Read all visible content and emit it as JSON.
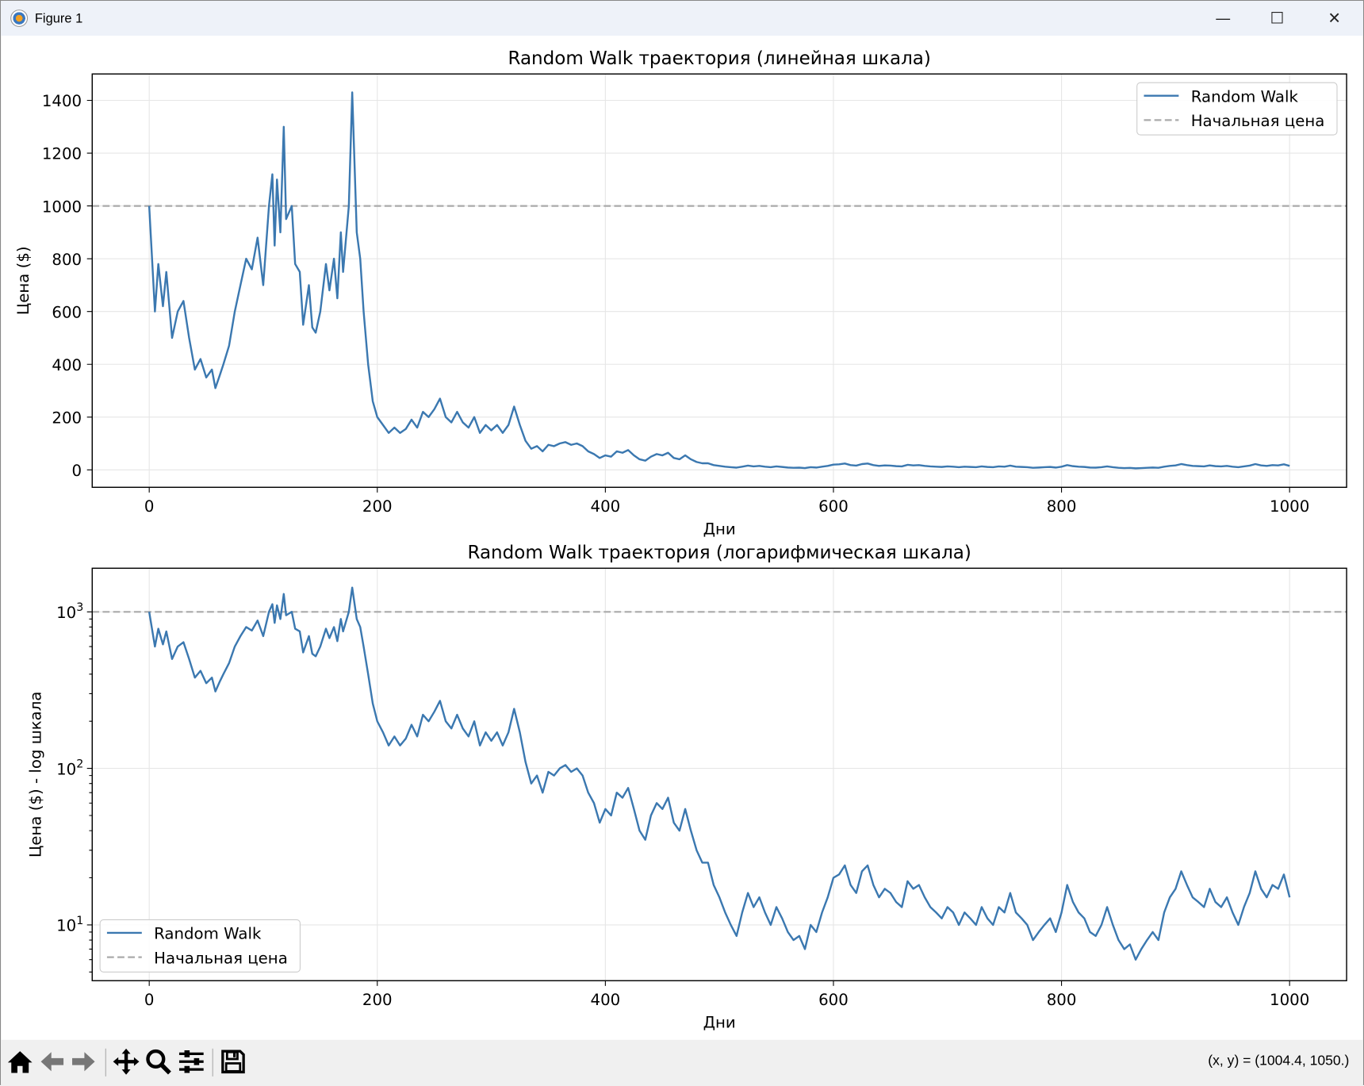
{
  "window": {
    "title": "Figure 1",
    "minimize": "—",
    "maximize": "☐",
    "close": "✕"
  },
  "toolbar": {
    "icons": [
      "home-icon",
      "back-icon",
      "forward-icon",
      "pan-icon",
      "zoom-icon",
      "configure-subplots-icon",
      "save-icon"
    ],
    "coords": "(x, y) = (1004.4, 1050.)"
  },
  "chart_data": [
    {
      "type": "line",
      "title": "Random Walk траектория (линейная шкала)",
      "xlabel": "Дни",
      "ylabel": "Цена ($)",
      "yscale": "linear",
      "xlim": [
        -50,
        1050
      ],
      "ylim": [
        -66,
        1500
      ],
      "xticks": [
        0,
        200,
        400,
        600,
        800,
        1000
      ],
      "xtick_labels": [
        "0",
        "200",
        "400",
        "600",
        "800",
        "1000"
      ],
      "yticks": [
        0,
        200,
        400,
        600,
        800,
        1000,
        1200,
        1400
      ],
      "ytick_labels": [
        "0",
        "200",
        "400",
        "600",
        "800",
        "1000",
        "1200",
        "1400"
      ],
      "grid": true,
      "legend": {
        "placement": "top-right",
        "entries": [
          "Random Walk",
          "Начальная цена"
        ]
      }
    },
    {
      "type": "line",
      "title": "Random Walk траектория (логарифмическая шкала)",
      "xlabel": "Дни",
      "ylabel": "Цена ($) - log шкала",
      "yscale": "log",
      "xlim": [
        -50,
        1050
      ],
      "ylim": [
        4.4,
        1900
      ],
      "xticks": [
        0,
        200,
        400,
        600,
        800,
        1000
      ],
      "xtick_labels": [
        "0",
        "200",
        "400",
        "600",
        "800",
        "1000"
      ],
      "yticks": [
        10,
        100,
        1000
      ],
      "ytick_labels": [
        [
          "10",
          "1"
        ],
        [
          "10",
          "2"
        ],
        [
          "10",
          "3"
        ]
      ],
      "grid": true,
      "legend": {
        "placement": "bottom-left",
        "entries": [
          "Random Walk",
          "Начальная цена"
        ]
      }
    }
  ],
  "series": {
    "random_walk": {
      "name": "Random Walk",
      "color": "#3b78b0",
      "x": [
        0,
        5,
        8,
        12,
        15,
        20,
        25,
        30,
        35,
        40,
        45,
        50,
        55,
        58,
        62,
        65,
        70,
        75,
        80,
        85,
        90,
        95,
        100,
        105,
        108,
        110,
        112,
        115,
        118,
        120,
        125,
        128,
        132,
        135,
        140,
        143,
        146,
        150,
        155,
        158,
        162,
        165,
        168,
        170,
        175,
        178,
        182,
        185,
        188,
        192,
        196,
        200,
        205,
        210,
        215,
        220,
        225,
        230,
        235,
        240,
        245,
        250,
        255,
        260,
        265,
        270,
        275,
        280,
        285,
        290,
        295,
        300,
        305,
        310,
        315,
        320,
        325,
        330,
        335,
        340,
        345,
        350,
        355,
        360,
        365,
        370,
        375,
        380,
        385,
        390,
        395,
        400,
        405,
        410,
        415,
        420,
        425,
        430,
        435,
        440,
        445,
        450,
        455,
        460,
        465,
        470,
        475,
        480,
        485,
        490,
        495,
        500,
        505,
        510,
        515,
        520,
        525,
        530,
        535,
        540,
        545,
        550,
        555,
        560,
        565,
        570,
        575,
        580,
        585,
        590,
        595,
        600,
        605,
        610,
        615,
        620,
        625,
        630,
        635,
        640,
        645,
        650,
        655,
        660,
        665,
        670,
        675,
        680,
        685,
        690,
        695,
        700,
        705,
        710,
        715,
        720,
        725,
        730,
        735,
        740,
        745,
        750,
        755,
        760,
        765,
        770,
        775,
        780,
        785,
        790,
        795,
        800,
        805,
        810,
        815,
        820,
        825,
        830,
        835,
        840,
        845,
        850,
        855,
        860,
        865,
        870,
        875,
        880,
        885,
        890,
        895,
        900,
        905,
        910,
        915,
        920,
        925,
        930,
        935,
        940,
        945,
        950,
        955,
        960,
        965,
        970,
        975,
        980,
        985,
        990,
        995,
        1000
      ],
      "y": [
        1000,
        600,
        780,
        620,
        750,
        500,
        600,
        640,
        500,
        380,
        420,
        350,
        380,
        310,
        360,
        400,
        470,
        600,
        700,
        800,
        760,
        880,
        700,
        1000,
        1120,
        850,
        1100,
        900,
        1300,
        950,
        1000,
        780,
        750,
        550,
        700,
        540,
        520,
        600,
        780,
        680,
        800,
        650,
        900,
        750,
        1000,
        1430,
        900,
        800,
        600,
        400,
        260,
        200,
        170,
        140,
        160,
        140,
        155,
        190,
        160,
        220,
        200,
        230,
        270,
        200,
        180,
        220,
        180,
        160,
        200,
        140,
        170,
        150,
        170,
        140,
        170,
        240,
        170,
        110,
        80,
        90,
        70,
        95,
        90,
        100,
        105,
        95,
        100,
        90,
        70,
        60,
        45,
        55,
        50,
        70,
        65,
        75,
        55,
        40,
        35,
        50,
        60,
        55,
        65,
        45,
        40,
        55,
        40,
        30,
        25,
        25,
        18,
        15,
        12,
        10,
        8.5,
        12,
        16,
        13,
        15,
        12,
        10,
        13,
        11,
        9,
        8,
        8.5,
        7,
        10,
        9,
        12,
        15,
        20,
        21,
        24,
        18,
        16,
        22,
        24,
        18,
        15,
        17,
        16,
        14,
        13,
        19,
        17,
        18,
        15,
        13,
        12,
        11,
        13,
        12,
        10,
        12,
        11,
        10,
        13,
        11,
        10,
        13,
        12,
        16,
        12,
        11,
        10,
        8,
        9,
        10,
        11,
        9,
        12,
        18,
        14,
        12,
        11,
        9,
        8.5,
        10,
        13,
        10,
        8,
        7,
        7.5,
        6,
        7,
        8,
        9,
        8,
        12,
        15,
        17,
        22,
        18,
        15,
        14,
        13,
        17,
        14,
        13,
        15,
        12,
        10,
        13,
        16,
        22,
        17,
        15,
        18,
        17,
        21,
        15
      ]
    },
    "start_price": {
      "name": "Начальная цена",
      "value": 1000,
      "color": "#aaaaaa"
    }
  }
}
